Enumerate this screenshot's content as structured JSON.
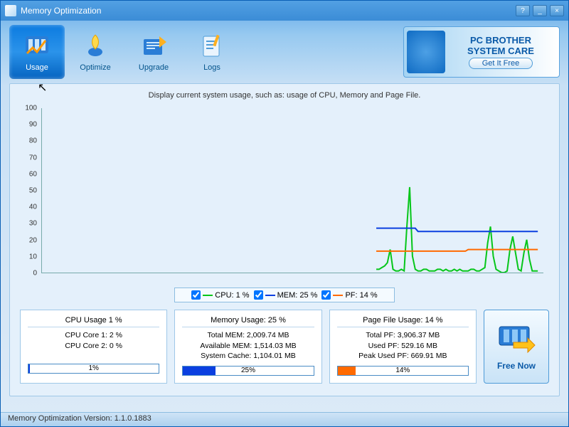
{
  "window": {
    "title": "Memory Optimization"
  },
  "toolbar": {
    "tabs": [
      {
        "label": "Usage",
        "active": true,
        "icon": "usage"
      },
      {
        "label": "Optimize",
        "active": false,
        "icon": "optimize"
      },
      {
        "label": "Upgrade",
        "active": false,
        "icon": "upgrade"
      },
      {
        "label": "Logs",
        "active": false,
        "icon": "logs"
      }
    ]
  },
  "ad": {
    "line1": "PC BROTHER",
    "line2": "SYSTEM CARE",
    "button": "Get It Free"
  },
  "description": "Display current system usage, such as: usage of CPU, Memory and Page File.",
  "chart_data": {
    "type": "line",
    "ylim": [
      0,
      100
    ],
    "yticks": [
      0,
      10,
      20,
      30,
      40,
      50,
      60,
      70,
      80,
      90,
      100
    ],
    "xrange": 180,
    "series_start": 120,
    "series": [
      {
        "name": "CPU",
        "current": "1 %",
        "color": "#06c61a",
        "values": [
          2,
          2,
          3,
          4,
          6,
          14,
          2,
          1,
          1,
          2,
          1,
          28,
          52,
          10,
          2,
          1,
          1,
          2,
          2,
          1,
          1,
          1,
          2,
          2,
          1,
          2,
          1,
          1,
          2,
          1,
          2,
          1,
          1,
          1,
          2,
          2,
          1,
          1,
          2,
          3,
          18,
          28,
          10,
          2,
          1,
          0,
          0,
          1,
          14,
          22,
          12,
          2,
          1,
          12,
          20,
          8,
          1,
          1,
          1
        ]
      },
      {
        "name": "MEM",
        "current": "25 %",
        "color": "#0b3fe0",
        "values": [
          27,
          27,
          27,
          27,
          27,
          27,
          27,
          27,
          27,
          27,
          27,
          27,
          27,
          27,
          27,
          25,
          25,
          25,
          25,
          25,
          25,
          25,
          25,
          25,
          25,
          25,
          25,
          25,
          25,
          25,
          25,
          25,
          25,
          25,
          25,
          25,
          25,
          25,
          25,
          25,
          25,
          25,
          25,
          25,
          25,
          25,
          25,
          25,
          25,
          25,
          25,
          25,
          25,
          25,
          25,
          25,
          25,
          25,
          25
        ]
      },
      {
        "name": "PF",
        "current": "14 %",
        "color": "#ff6a00",
        "values": [
          13,
          13,
          13,
          13,
          13,
          13,
          13,
          13,
          13,
          13,
          13,
          13,
          13,
          13,
          13,
          13,
          13,
          13,
          13,
          13,
          13,
          13,
          13,
          13,
          13,
          13,
          13,
          13,
          13,
          13,
          13,
          13,
          13,
          14,
          14,
          14,
          14,
          14,
          14,
          14,
          14,
          14,
          14,
          14,
          14,
          14,
          14,
          14,
          14,
          14,
          14,
          14,
          14,
          14,
          14,
          14,
          14,
          14,
          14
        ]
      }
    ]
  },
  "legend": {
    "items": [
      {
        "label": "CPU: 1 %",
        "color": "#06c61a",
        "checked": true
      },
      {
        "label": "MEM: 25 %",
        "color": "#0b3fe0",
        "checked": true
      },
      {
        "label": "PF: 14 %",
        "color": "#ff6a00",
        "checked": true
      }
    ]
  },
  "panels": {
    "cpu": {
      "title": "CPU Usage 1 %",
      "line1": "CPU Core 1: 2 %",
      "line2": "CPU Core 2: 0 %",
      "bar": {
        "pct": 1,
        "label": "1%",
        "color": "#0b3fe0"
      }
    },
    "mem": {
      "title": "Memory Usage: 25 %",
      "line1": "Total MEM: 2,009.74 MB",
      "line2": "Available MEM: 1,514.03 MB",
      "line3": "System Cache: 1,104.01 MB",
      "bar": {
        "pct": 25,
        "label": "25%",
        "color": "#0b3fe0"
      }
    },
    "pf": {
      "title": "Page File Usage: 14 %",
      "line1": "Total PF: 3,906.37 MB",
      "line2": "Used PF: 529.16 MB",
      "line3": "Peak Used PF: 669.91 MB",
      "bar": {
        "pct": 14,
        "label": "14%",
        "color": "#ff6a00"
      }
    }
  },
  "action": {
    "label": "Free Now"
  },
  "statusbar": "Memory Optimization Version: 1.1.0.1883"
}
